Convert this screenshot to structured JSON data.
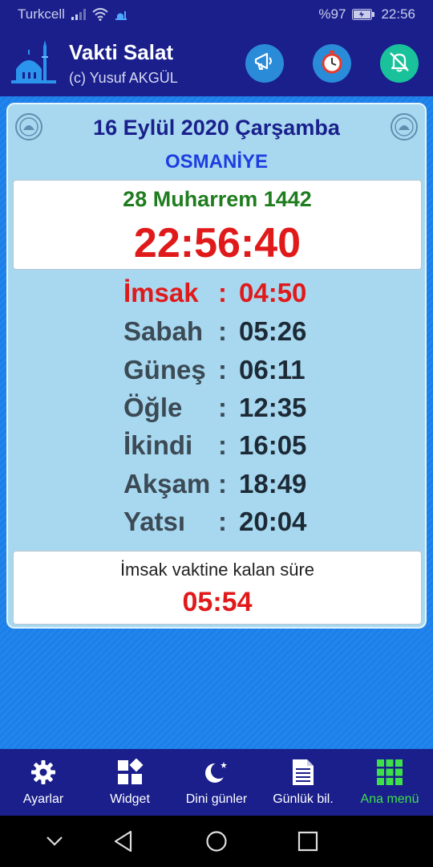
{
  "status_bar": {
    "carrier": "Turkcell",
    "battery": "%97",
    "time": "22:56"
  },
  "header": {
    "title": "Vakti Salat",
    "subtitle": "(c) Yusuf AKGÜL",
    "buttons": [
      "megaphone-icon",
      "stopwatch-icon",
      "bell-off-icon"
    ],
    "colors": {
      "bar": "#1a1f8c",
      "megaphone_btn": "#2a8bd9",
      "stopwatch_btn": "#2a8bd9",
      "bell_btn": "#19c29a"
    }
  },
  "main": {
    "date": "16 Eylül 2020 Çarşamba",
    "city": "OSMANİYE",
    "hijri_date": "28 Muharrem 1442",
    "clock": "22:56:40",
    "times": [
      {
        "name": "İmsak",
        "sep": ":",
        "value": "04:50",
        "active": true
      },
      {
        "name": "Sabah",
        "sep": ":",
        "value": "05:26",
        "active": false
      },
      {
        "name": "Güneş",
        "sep": ":",
        "value": "06:11",
        "active": false
      },
      {
        "name": "Öğle",
        "sep": ":",
        "value": "12:35",
        "active": false
      },
      {
        "name": "İkindi",
        "sep": ":",
        "value": "16:05",
        "active": false
      },
      {
        "name": "Akşam",
        "sep": ":",
        "value": "18:49",
        "active": false
      },
      {
        "name": "Yatsı",
        "sep": ":",
        "value": "20:04",
        "active": false
      }
    ],
    "remaining_label": "İmsak vaktine kalan süre",
    "remaining_value": "05:54"
  },
  "bottom_nav": {
    "items": [
      {
        "label": "Ayarlar",
        "icon": "gear-icon",
        "active": false
      },
      {
        "label": "Widget",
        "icon": "widget-icon",
        "active": false
      },
      {
        "label": "Dini günler",
        "icon": "crescent-star-icon",
        "active": false
      },
      {
        "label": "Günlük bil.",
        "icon": "document-icon",
        "active": false
      },
      {
        "label": "Ana menü",
        "icon": "grid-icon",
        "active": true
      }
    ],
    "active_color": "#3ee04a"
  },
  "system_nav": [
    "chevron-down-icon",
    "back-icon",
    "home-icon",
    "recents-icon"
  ]
}
